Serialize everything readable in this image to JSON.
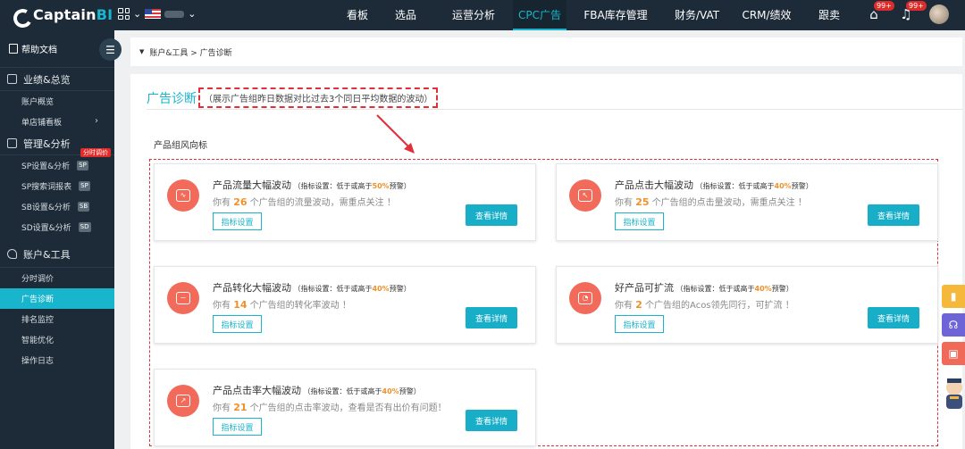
{
  "brand": {
    "name_main": "Captain",
    "name_accent": "BI"
  },
  "nav": [
    "看板",
    "选品",
    "运营分析",
    "CPC广告",
    "FBA库存管理",
    "财务/VAT",
    "CRM/绩效",
    "跟卖"
  ],
  "nav_active_index": 3,
  "badges": {
    "notify1": "99+",
    "notify2": "99+"
  },
  "sidebar": {
    "help": "帮助文档",
    "sections": [
      {
        "label": "业绩&总览",
        "items": [
          {
            "label": "账户概览"
          },
          {
            "label": "单店铺看板"
          }
        ]
      },
      {
        "label": "管理&分析",
        "hot": "分时调价",
        "items": [
          {
            "label": "SP设置&分析",
            "tag": "SP"
          },
          {
            "label": "SP搜索词报表",
            "tag": "SP"
          },
          {
            "label": "SB设置&分析",
            "tag": "SB"
          },
          {
            "label": "SD设置&分析",
            "tag": "SD"
          }
        ]
      },
      {
        "label": "账户&工具",
        "items": [
          {
            "label": "分时调价"
          },
          {
            "label": "广告诊断"
          },
          {
            "label": "排名监控"
          },
          {
            "label": "智能优化"
          },
          {
            "label": "操作日志"
          }
        ]
      }
    ]
  },
  "breadcrumb": "账户&工具 > 广告诊断",
  "page": {
    "title": "广告诊断",
    "subtitle": "（展示广告组昨日数据对比过去3个同日平均数据的波动）",
    "section_label": "产品组风向标"
  },
  "cards": [
    {
      "title": "产品流量大幅波动",
      "setting_pre": "（指标设置：低于或高于",
      "pct": "50%",
      "setting_post": "预警）",
      "desc_pre": "你有",
      "count": "26",
      "desc_post": "个广告组的流量波动，需重点关注 ！",
      "set_btn": "指标设置",
      "detail_btn": "查看详情",
      "icon": "pulse-icon"
    },
    {
      "title": "产品点击大幅波动",
      "setting_pre": "（指标设置：低于或高于",
      "pct": "40%",
      "setting_post": "预警）",
      "desc_pre": "你有",
      "count": "25",
      "desc_post": "个广告组的点击量波动，需重点关注 ！",
      "set_btn": "指标设置",
      "detail_btn": "查看详情",
      "icon": "cursor-icon"
    },
    {
      "title": "产品转化大幅波动",
      "setting_pre": "（指标设置：低于或高于",
      "pct": "40%",
      "setting_post": "预警）",
      "desc_pre": "你有",
      "count": "14",
      "desc_post": "个广告组的转化率波动 ！",
      "set_btn": "指标设置",
      "detail_btn": "查看详情",
      "icon": "wave-icon"
    },
    {
      "title": "好产品可扩流",
      "setting_pre": "（指标设置：低于或高于",
      "pct": "40%",
      "setting_post": "预警）",
      "desc_pre": "你有",
      "count": "2",
      "desc_post": "个广告组的Acos领先同行，可扩流 ！",
      "set_btn": "指标设置",
      "detail_btn": "查看详情",
      "icon": "expand-icon"
    },
    {
      "title": "产品点击率大幅波动",
      "setting_pre": "（指标设置：低于或高于",
      "pct": "40%",
      "setting_post": "预警）",
      "desc_pre": "你有",
      "count": "21",
      "desc_post": "个广告组的点击率波动，查看是否有出价有问题！",
      "set_btn": "指标设置",
      "detail_btn": "查看详情",
      "icon": "trend-icon"
    }
  ],
  "colors": {
    "accent": "#18b5cc",
    "alert": "#e0303a",
    "highlight": "#f0902a",
    "card_icon": "#f26a5a",
    "dark": "#1d2b38"
  }
}
